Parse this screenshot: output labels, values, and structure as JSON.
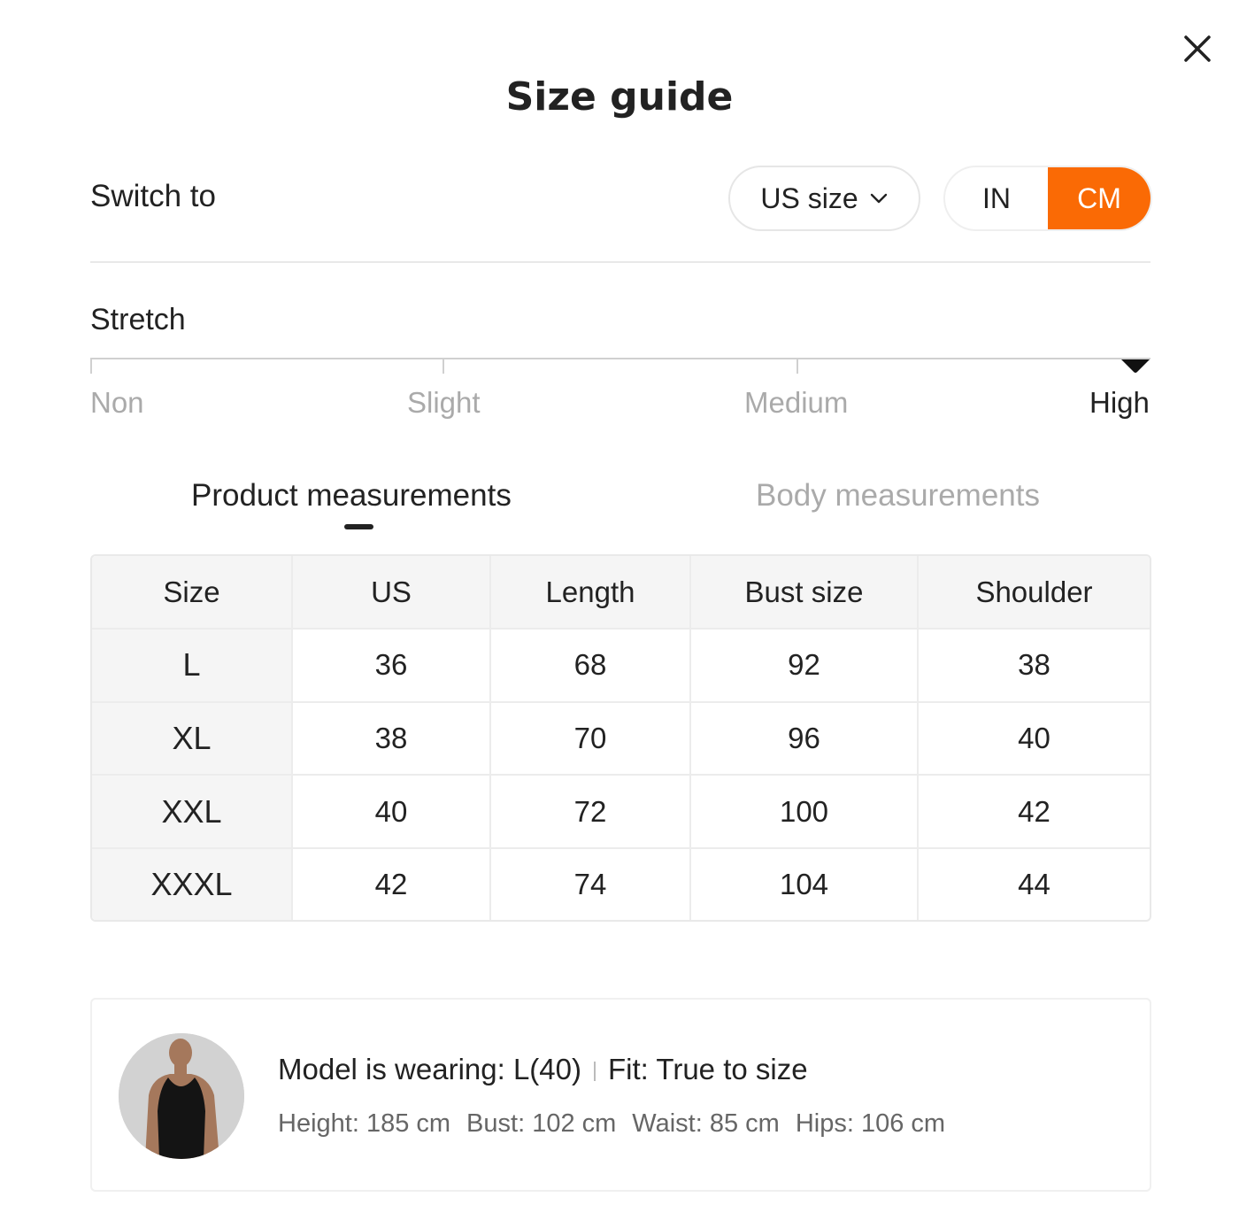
{
  "dialog": {
    "title": "Size guide",
    "close_icon": "close-icon"
  },
  "switch": {
    "label": "Switch to",
    "size_system": "US size",
    "units": [
      "IN",
      "CM"
    ],
    "active_unit": "CM",
    "accent_color": "#fa6a05"
  },
  "stretch": {
    "label": "Stretch",
    "options": [
      "Non",
      "Slight",
      "Medium",
      "High"
    ],
    "selected": "High"
  },
  "tabs": {
    "items": [
      "Product measurements",
      "Body measurements"
    ],
    "active": "Product measurements"
  },
  "table": {
    "headers": [
      "Size",
      "US",
      "Length",
      "Bust size",
      "Shoulder"
    ],
    "rows": [
      [
        "L",
        "36",
        "68",
        "92",
        "38"
      ],
      [
        "XL",
        "38",
        "70",
        "96",
        "40"
      ],
      [
        "XXL",
        "40",
        "72",
        "100",
        "42"
      ],
      [
        "XXXL",
        "42",
        "74",
        "104",
        "44"
      ]
    ]
  },
  "model": {
    "wearing": "Model is wearing: L(40)",
    "fit": "Fit: True to size",
    "stats": [
      "Height: 185 cm",
      "Bust: 102 cm",
      "Waist: 85 cm",
      "Hips: 106 cm"
    ]
  }
}
